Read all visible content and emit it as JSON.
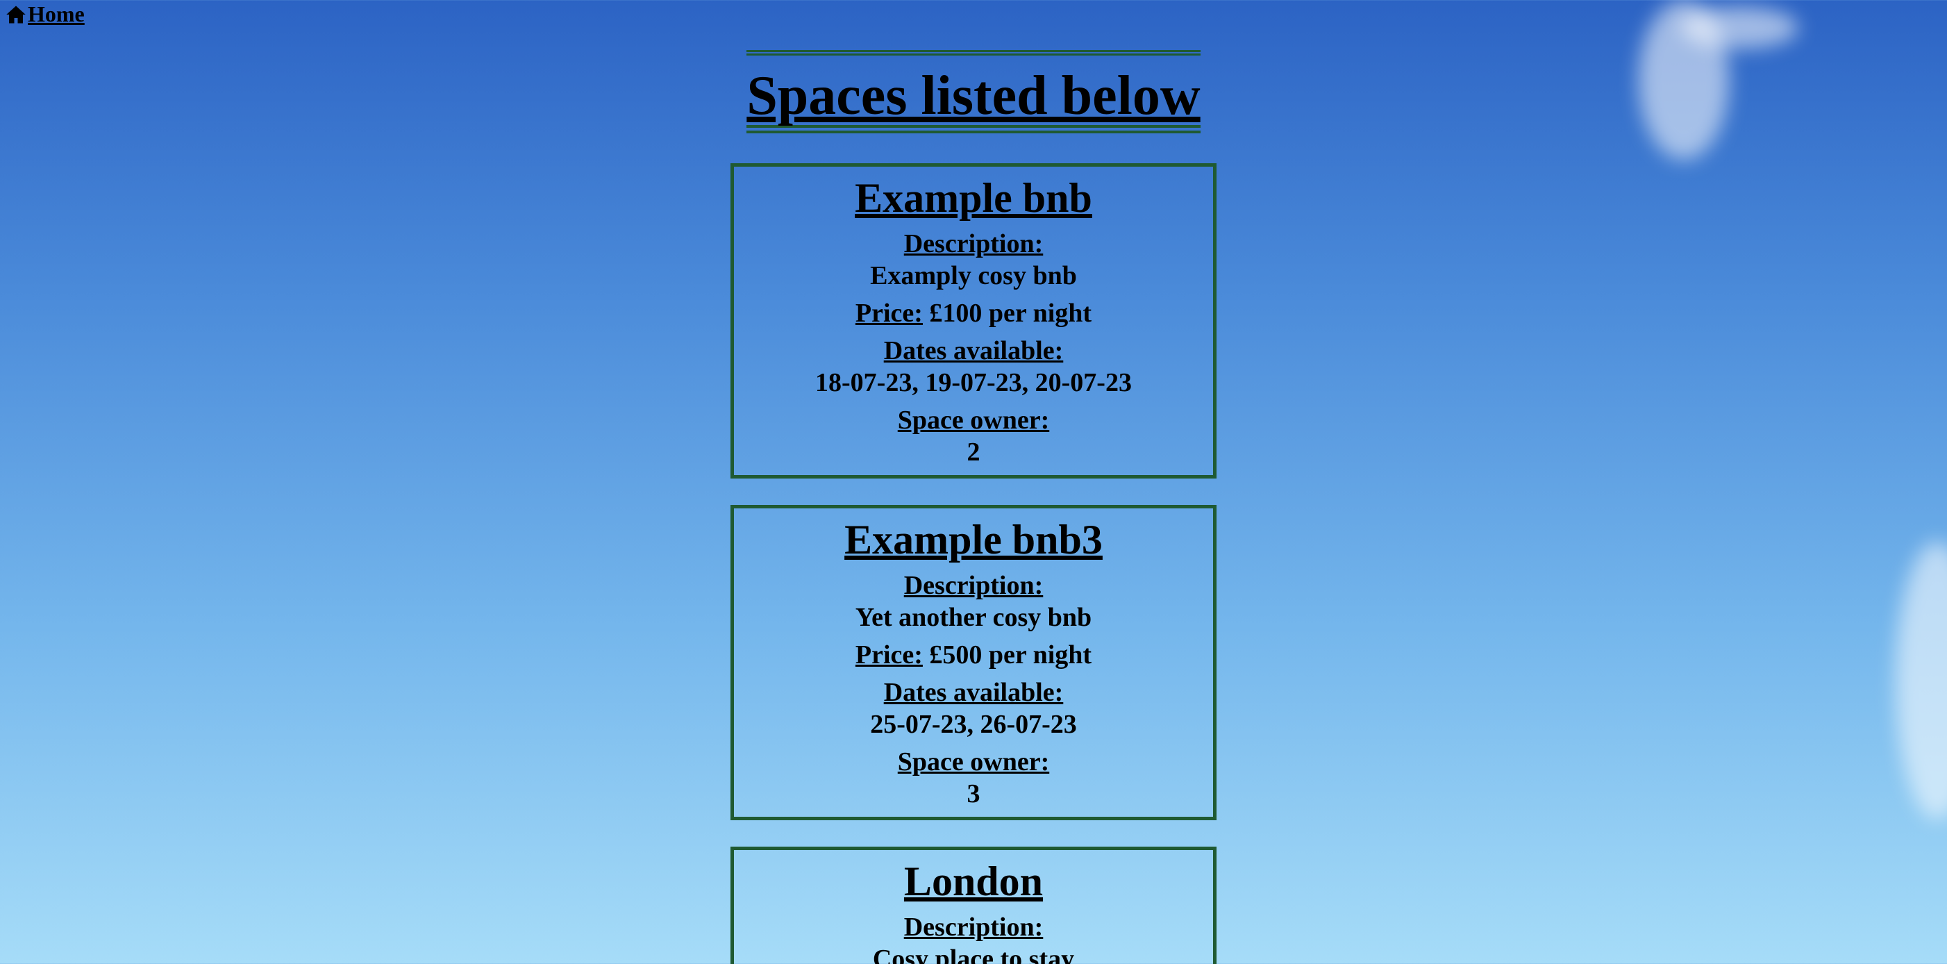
{
  "nav": {
    "home_label": "Home"
  },
  "page": {
    "title": "Spaces listed below"
  },
  "spaces": [
    {
      "name": "Example bnb",
      "description_label": "Description:",
      "description": "Examply cosy bnb",
      "price_label": "Price:",
      "price": "£100 per night",
      "dates_label": "Dates available:",
      "dates": "18-07-23, 19-07-23, 20-07-23",
      "owner_label": "Space owner:",
      "owner": "2"
    },
    {
      "name": "Example bnb3",
      "description_label": "Description:",
      "description": "Yet another cosy bnb",
      "price_label": "Price:",
      "price": "£500 per night",
      "dates_label": "Dates available:",
      "dates": "25-07-23, 26-07-23",
      "owner_label": "Space owner:",
      "owner": "3"
    },
    {
      "name": "London",
      "description_label": "Description:",
      "description": "Cosy place to stay"
    }
  ],
  "colors": {
    "border_green": "#1f5a32",
    "sky_top": "#2c63c4",
    "sky_bottom": "#a6dcf8"
  },
  "icons": {
    "home": "house-icon"
  }
}
